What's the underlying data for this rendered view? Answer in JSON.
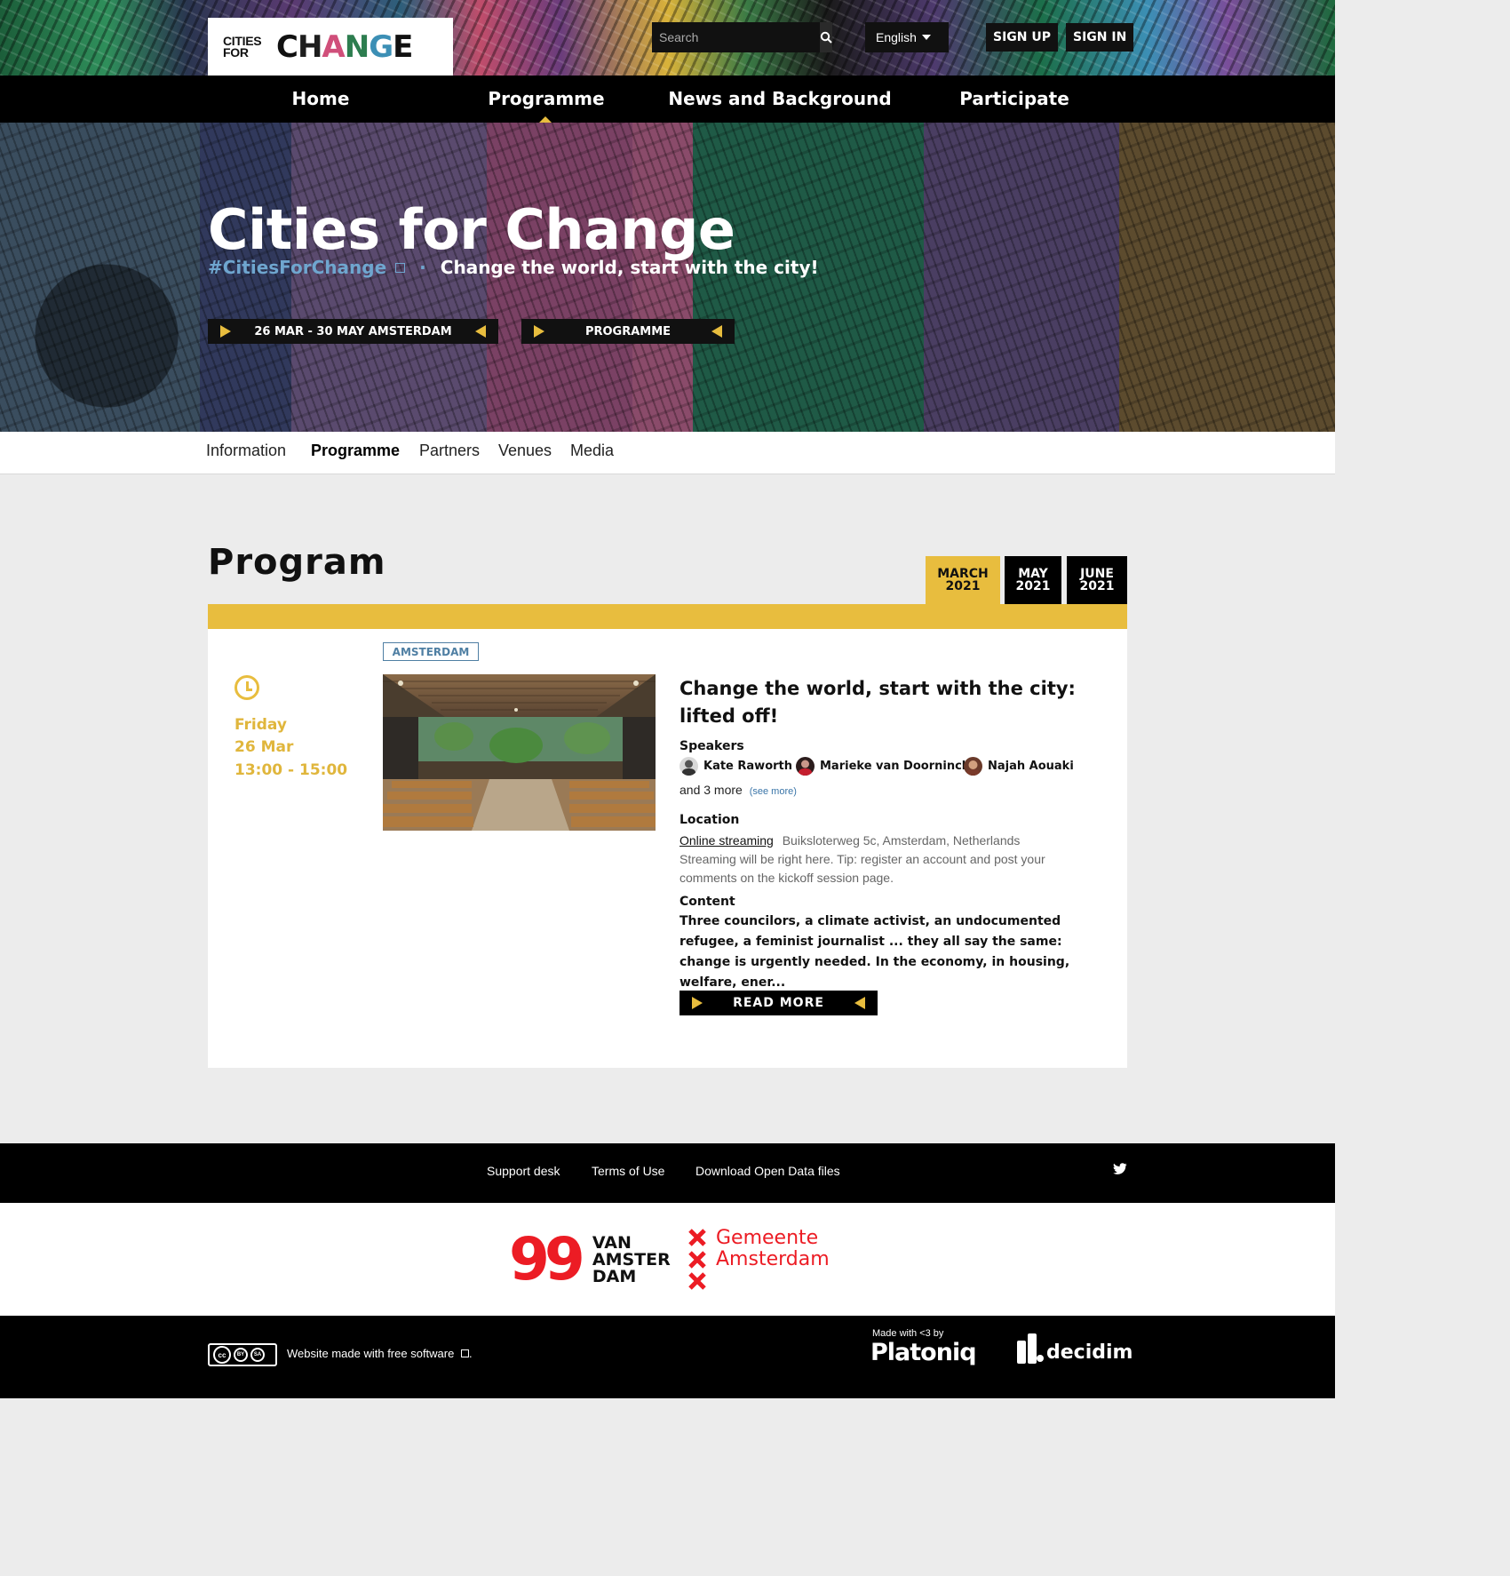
{
  "header": {
    "logo_small": "CITIES FOR",
    "logo_big": [
      "C",
      "H",
      "A",
      "N",
      "G",
      "E"
    ],
    "search_placeholder": "Search",
    "language": "English",
    "sign_up": "SIGN UP",
    "sign_in": "SIGN IN"
  },
  "main_nav": [
    {
      "label": "Home"
    },
    {
      "label": "Programme",
      "active": true
    },
    {
      "label": "News and Background"
    },
    {
      "label": "Participate"
    }
  ],
  "hero": {
    "title": "Cities for Change",
    "hashtag": "#CitiesForChange",
    "separator": "·",
    "tagline": "Change the world, start with the city!",
    "button_dates": "26 MAR - 30 MAY AMSTERDAM",
    "button_programme": "PROGRAMME"
  },
  "sub_nav": [
    {
      "label": "Information"
    },
    {
      "label": "Programme",
      "active": true
    },
    {
      "label": "Partners"
    },
    {
      "label": "Venues"
    },
    {
      "label": "Media"
    }
  ],
  "program": {
    "title": "Program",
    "month_tabs": [
      {
        "line1": "MARCH",
        "line2": "2021",
        "active": true
      },
      {
        "line1": "MAY",
        "line2": "2021"
      },
      {
        "line1": "JUNE",
        "line2": "2021"
      }
    ],
    "event": {
      "day": "Friday",
      "date": "26 Mar",
      "time": "13:00 - 15:00",
      "tag": "AMSTERDAM",
      "title": "Change the world, start with the city: lifted off!",
      "speakers_label": "Speakers",
      "speakers": [
        "Kate Raworth",
        "Marieke van Doorninck",
        "Najah Aouaki"
      ],
      "more_text": "and 3 more",
      "see_more": "(see more)",
      "location_label": "Location",
      "location_link": "Online streaming",
      "address": "Buiksloterweg 5c, Amsterdam, Netherlands",
      "location_note": "Streaming will be right here. Tip: register an account and post your comments on the kickoff session page.",
      "content_label": "Content",
      "content": "Three councilors, a climate activist, an undocumented refugee, a feminist journalist ... they all say the same: change is urgently needed. In the economy, in housing, welfare, ener...",
      "read_more": "READ MORE"
    }
  },
  "footer": {
    "links": [
      "Support desk",
      "Terms of Use",
      "Download Open Data files"
    ],
    "sponsor_99": "99",
    "sponsor_99_text": [
      "VAN",
      "AMSTER",
      "DAM"
    ],
    "sponsor_gemeente": [
      "Gemeente",
      "Amsterdam"
    ],
    "cc_labels": [
      "BY",
      "SA"
    ],
    "free_software": "Website made with free software",
    "made_with": "Made with <3 by",
    "platoniq": "Platoniq",
    "decidim": "decidim"
  },
  "colors": {
    "accent_yellow": "#e8bd3e",
    "link_blue": "#6fa6cf",
    "tag_blue": "#4f7fa3",
    "gemeente_red": "#ec1c24"
  }
}
